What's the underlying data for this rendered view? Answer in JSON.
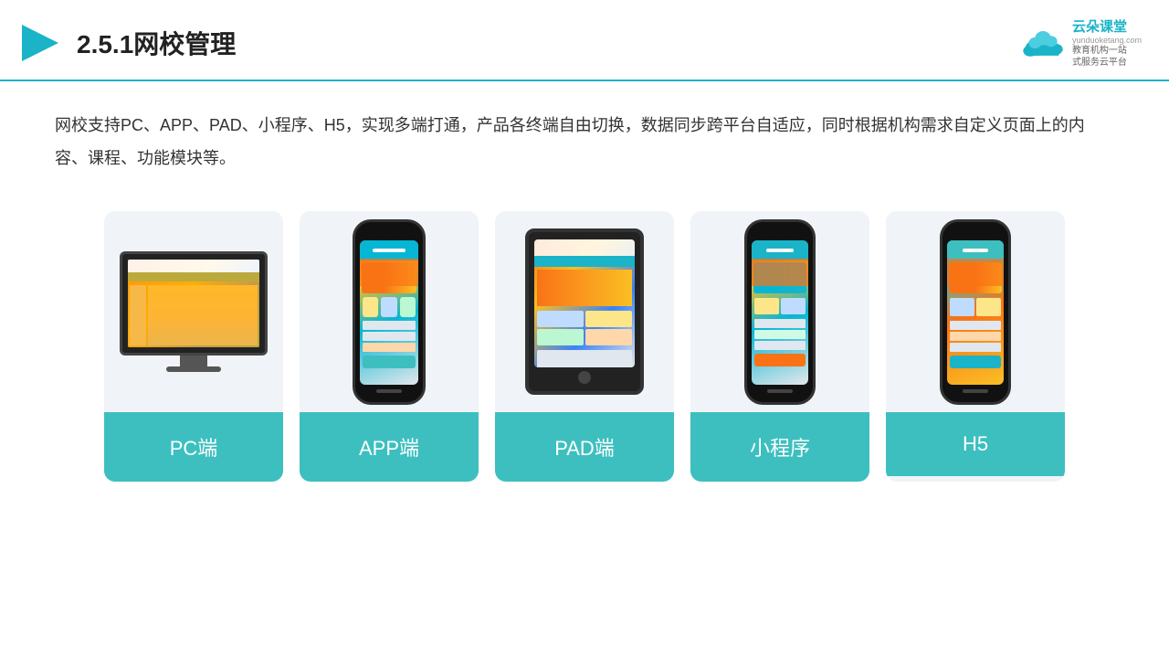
{
  "header": {
    "title": "2.5.1网校管理",
    "logo_name": "云朵课堂",
    "logo_url": "yunduoketang.com",
    "logo_tagline_line1": "教育机构一站",
    "logo_tagline_line2": "式服务云平台"
  },
  "description": {
    "text": "网校支持PC、APP、PAD、小程序、H5，实现多端打通，产品各终端自由切换，数据同步跨平台自适应，同时根据机构需求自定义页面上的内容、课程、功能模块等。"
  },
  "cards": [
    {
      "id": "pc",
      "label": "PC端"
    },
    {
      "id": "app",
      "label": "APP端"
    },
    {
      "id": "pad",
      "label": "PAD端"
    },
    {
      "id": "miniprogram",
      "label": "小程序"
    },
    {
      "id": "h5",
      "label": "H5"
    }
  ]
}
